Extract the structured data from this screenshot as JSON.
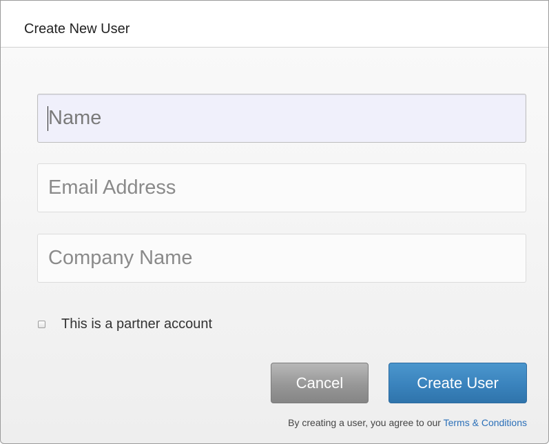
{
  "dialog": {
    "title": "Create New User"
  },
  "form": {
    "name_placeholder": "Name",
    "email_placeholder": "Email Address",
    "company_placeholder": "Company Name",
    "partner_checkbox_label": "This is a partner account",
    "partner_checkbox_checked": false
  },
  "buttons": {
    "cancel_label": "Cancel",
    "create_label": "Create User"
  },
  "footer": {
    "terms_prefix": "By creating a user, you agree to our",
    "terms_link": "Terms & Conditions"
  },
  "colors": {
    "primary_button": "#3a83bd",
    "secondary_button": "#979797",
    "link": "#2a6fb8"
  }
}
